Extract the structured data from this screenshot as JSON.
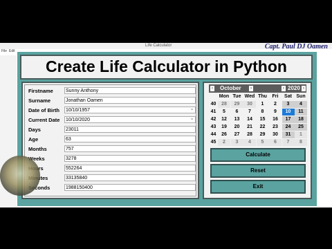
{
  "window": {
    "title": "Life Calculator",
    "menu": [
      "File",
      "Edit"
    ],
    "watermark": "Capt. Paul DJ Oamen"
  },
  "header": {
    "title": "Create Life Calculator in Python"
  },
  "form": {
    "labels": {
      "firstname": "Firstname",
      "surname": "Surname",
      "dob": "Date of Birth",
      "current_date": "Current Date",
      "days": "Days",
      "age": "Age",
      "months": "Months",
      "weeks": "Weeks",
      "hours": "Hours",
      "minutes": "Minutes",
      "seconds": "Seconds"
    },
    "values": {
      "firstname": "Sunny Anthony",
      "surname": "Jonathan Oamen",
      "dob": "10/10/1957",
      "current_date": "10/10/2020",
      "days": "23011",
      "age": "63",
      "months": "757",
      "weeks": "3278",
      "hours": "552264",
      "minutes": "33135840",
      "seconds": "1988150400"
    }
  },
  "calendar": {
    "month": "October",
    "year": "2020",
    "prev_month": "‹",
    "next_month": "›",
    "prev_year": "‹",
    "next_year": "›",
    "weekdays": [
      "Mon",
      "Tue",
      "Wed",
      "Thu",
      "Fri",
      "Sat",
      "Sun"
    ],
    "weeks": [
      "40",
      "41",
      "42",
      "43",
      "44",
      "45"
    ],
    "rows": [
      [
        "28",
        "29",
        "30",
        "1",
        "2",
        "3",
        "4"
      ],
      [
        "5",
        "6",
        "7",
        "8",
        "9",
        "10",
        "11"
      ],
      [
        "12",
        "13",
        "14",
        "15",
        "16",
        "17",
        "18"
      ],
      [
        "19",
        "20",
        "21",
        "22",
        "23",
        "24",
        "25"
      ],
      [
        "26",
        "27",
        "28",
        "29",
        "30",
        "31",
        "1"
      ],
      [
        "2",
        "3",
        "4",
        "5",
        "6",
        "7",
        "8"
      ]
    ],
    "selected": "10"
  },
  "buttons": {
    "calculate": "Calculate",
    "reset": "Reset",
    "exit": "Exit"
  },
  "colors": {
    "frame": "#5aa3a0",
    "selected_day": "#1e7bd6",
    "button": "#5aa3a0"
  }
}
